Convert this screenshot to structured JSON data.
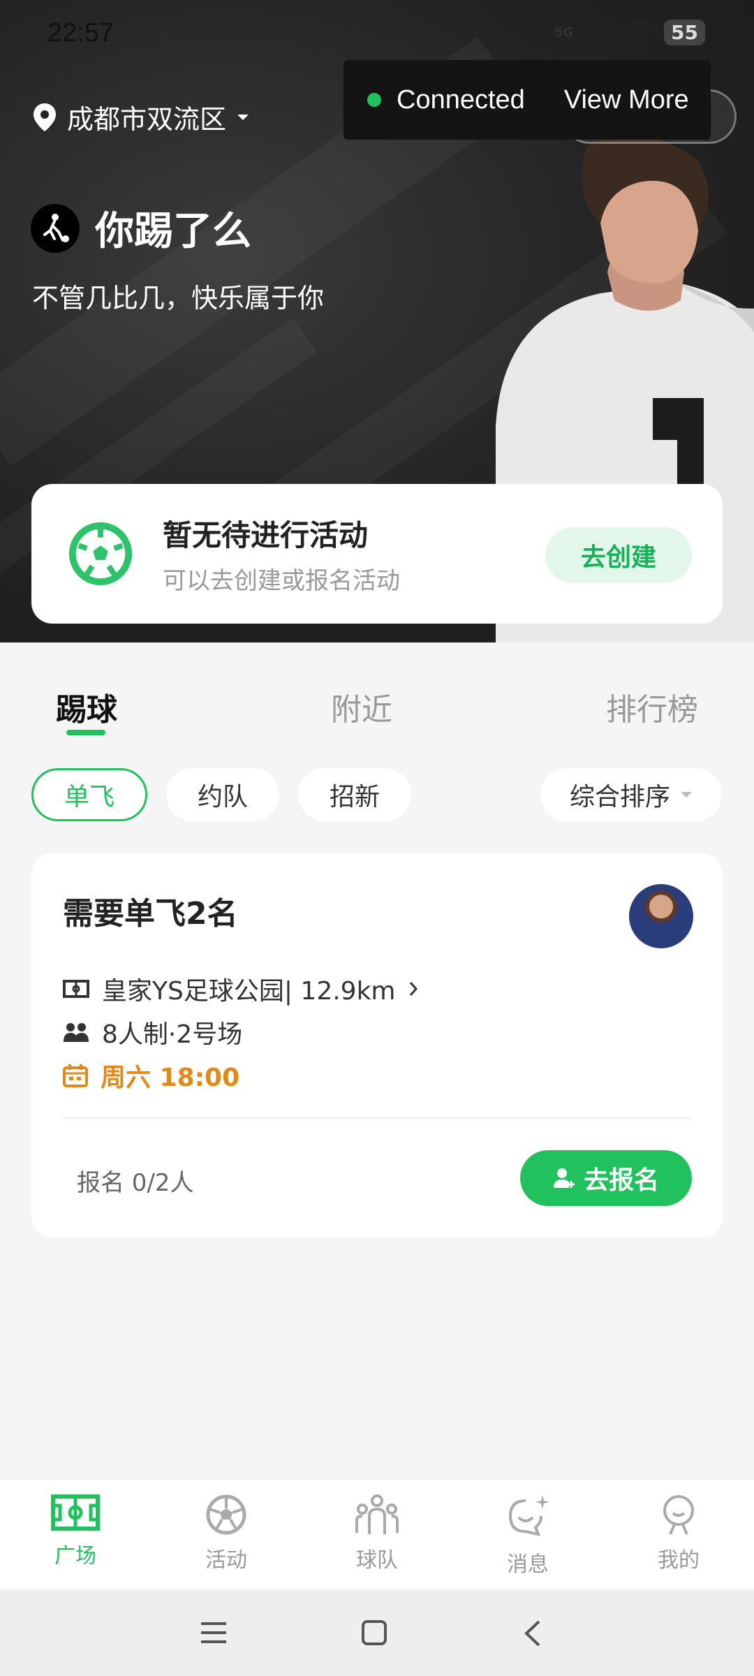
{
  "status_bar": {
    "time": "22:57",
    "network": "5G",
    "battery": "55"
  },
  "toast": {
    "status": "Connected",
    "action": "View More"
  },
  "header": {
    "location": "成都市双流区",
    "title": "你踢了么",
    "slogan": "不管几比几，快乐属于你"
  },
  "activity_card": {
    "title": "暂无待进行活动",
    "subtitle": "可以去创建或报名活动",
    "button": "去创建"
  },
  "tabs": [
    {
      "label": "踢球",
      "active": true
    },
    {
      "label": "附近",
      "active": false
    },
    {
      "label": "排行榜",
      "active": false
    }
  ],
  "filters": {
    "chips": [
      {
        "label": "单飞",
        "active": true
      },
      {
        "label": "约队",
        "active": false
      },
      {
        "label": "招新",
        "active": false
      }
    ],
    "sort": "综合排序"
  },
  "game": {
    "title": "需要单飞2名",
    "venue": "皇家YS足球公园| 12.9km",
    "format": "8人制·2号场",
    "time": "周六 18:00",
    "signup": "报名 0/2人",
    "button": "去报名"
  },
  "bottom_nav": [
    {
      "label": "广场",
      "icon": "field-icon",
      "active": true
    },
    {
      "label": "活动",
      "icon": "soccer-ball-icon",
      "active": false
    },
    {
      "label": "球队",
      "icon": "team-icon",
      "active": false
    },
    {
      "label": "消息",
      "icon": "message-icon",
      "active": false
    },
    {
      "label": "我的",
      "icon": "profile-icon",
      "active": false
    }
  ],
  "colors": {
    "accent": "#21c25e",
    "time_highlight": "#e08a1a",
    "hero_bg": "#232323"
  }
}
